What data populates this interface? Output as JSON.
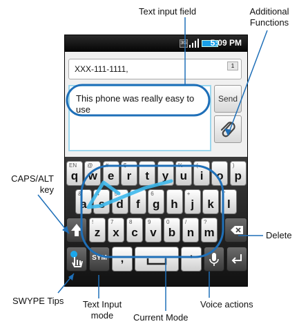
{
  "callouts": {
    "text_input_field": "Text input field",
    "additional_functions_line1": "Additional",
    "additional_functions_line2": "Functions",
    "caps_alt_line1": "CAPS/ALT",
    "caps_alt_line2": "key",
    "delete": "Delete",
    "swype_tips": "SWYPE Tips",
    "text_input_mode_line1": "Text Input",
    "text_input_mode_line2": "mode",
    "current_mode": "Current Mode",
    "voice_actions": "Voice actions"
  },
  "status_bar": {
    "time": "5:09 PM",
    "network": "3G"
  },
  "compose": {
    "recipient": "XXX-111-1111,",
    "recipient_count": "1",
    "message_text": "This phone was really easy to use",
    "send_label": "Send"
  },
  "keyboard": {
    "row1": [
      {
        "key": "q",
        "sub": "EN"
      },
      {
        "key": "w",
        "sub": "@"
      },
      {
        "key": "e",
        "sub": "#"
      },
      {
        "key": "r",
        "sub": "$"
      },
      {
        "key": "t",
        "sub": ""
      },
      {
        "key": "y",
        "sub": ""
      },
      {
        "key": "u",
        "sub": "%"
      },
      {
        "key": "i",
        "sub": "("
      },
      {
        "key": "o",
        "sub": ""
      },
      {
        "key": "p",
        "sub": ")"
      }
    ],
    "row2": [
      {
        "key": "a",
        "sub": "&"
      },
      {
        "key": "s",
        "sub": "4"
      },
      {
        "key": "d",
        "sub": "5"
      },
      {
        "key": "f",
        "sub": ""
      },
      {
        "key": "g",
        "sub": "6"
      },
      {
        "key": "h",
        "sub": ""
      },
      {
        "key": "j",
        "sub": "+"
      },
      {
        "key": "k",
        "sub": ""
      },
      {
        "key": "l",
        "sub": "\""
      }
    ],
    "row3": [
      {
        "key": "z",
        "sub": "!"
      },
      {
        "key": "x",
        "sub": "7"
      },
      {
        "key": "c",
        "sub": "8"
      },
      {
        "key": "v",
        "sub": "9"
      },
      {
        "key": "b",
        "sub": "0"
      },
      {
        "key": "n",
        "sub": "/"
      },
      {
        "key": "m",
        "sub": "?"
      }
    ],
    "sym_label": "SYM",
    "punct_left": ";",
    "punct_right": "'"
  }
}
